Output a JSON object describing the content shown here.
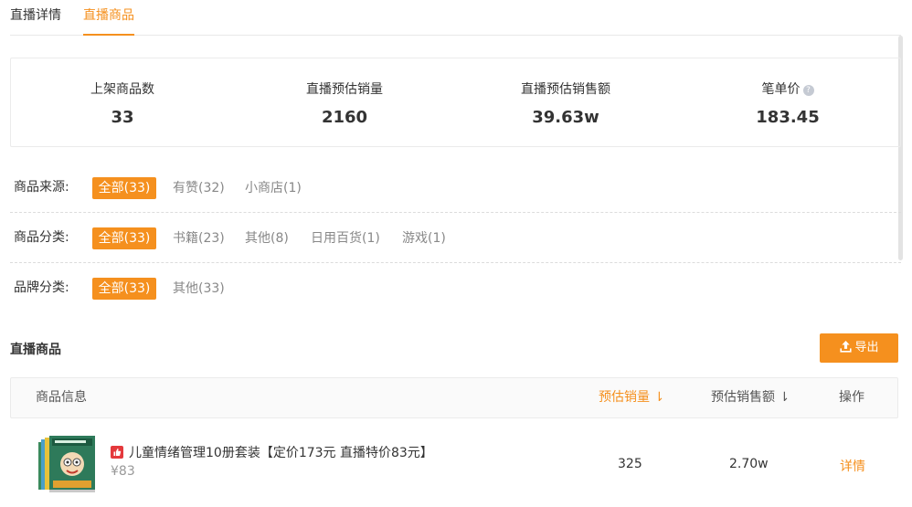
{
  "tabs": [
    {
      "label": "直播详情"
    },
    {
      "label": "直播商品",
      "active": true
    }
  ],
  "stats": [
    {
      "label": "上架商品数",
      "value": "33"
    },
    {
      "label": "直播预估销量",
      "value": "2160"
    },
    {
      "label": "直播预估销售额",
      "value": "39.63w"
    },
    {
      "label": "笔单价",
      "value": "183.45",
      "help": "?"
    }
  ],
  "filters": {
    "source": {
      "label": "商品来源:",
      "options": [
        "全部(33)",
        "有赞(32)",
        "小商店(1)"
      ],
      "selected": 0
    },
    "category": {
      "label": "商品分类:",
      "options": [
        "全部(33)",
        "书籍(23)",
        "其他(8)",
        "日用百货(1)",
        "游戏(1)"
      ],
      "selected": 0
    },
    "brand": {
      "label": "品牌分类:",
      "options": [
        "全部(33)",
        "其他(33)"
      ],
      "selected": 0
    }
  },
  "section": {
    "title": "直播商品",
    "export_label": "导出"
  },
  "table": {
    "headers": [
      "商品信息",
      "预估销量 ⇂",
      "预估销售额 ⇂",
      "操作"
    ],
    "rows": [
      {
        "title": "儿童情绪管理10册套装【定价173元 直播特价83元】",
        "price": "¥83",
        "sales": "325",
        "revenue": "2.70w",
        "action": "详情"
      }
    ]
  },
  "colors": {
    "accent": "#f5901e",
    "brand_badge": "#e4393c"
  },
  "icons": {
    "export": "upload-icon",
    "help": "help-circle-icon",
    "badge": "thumbs-up-icon"
  }
}
